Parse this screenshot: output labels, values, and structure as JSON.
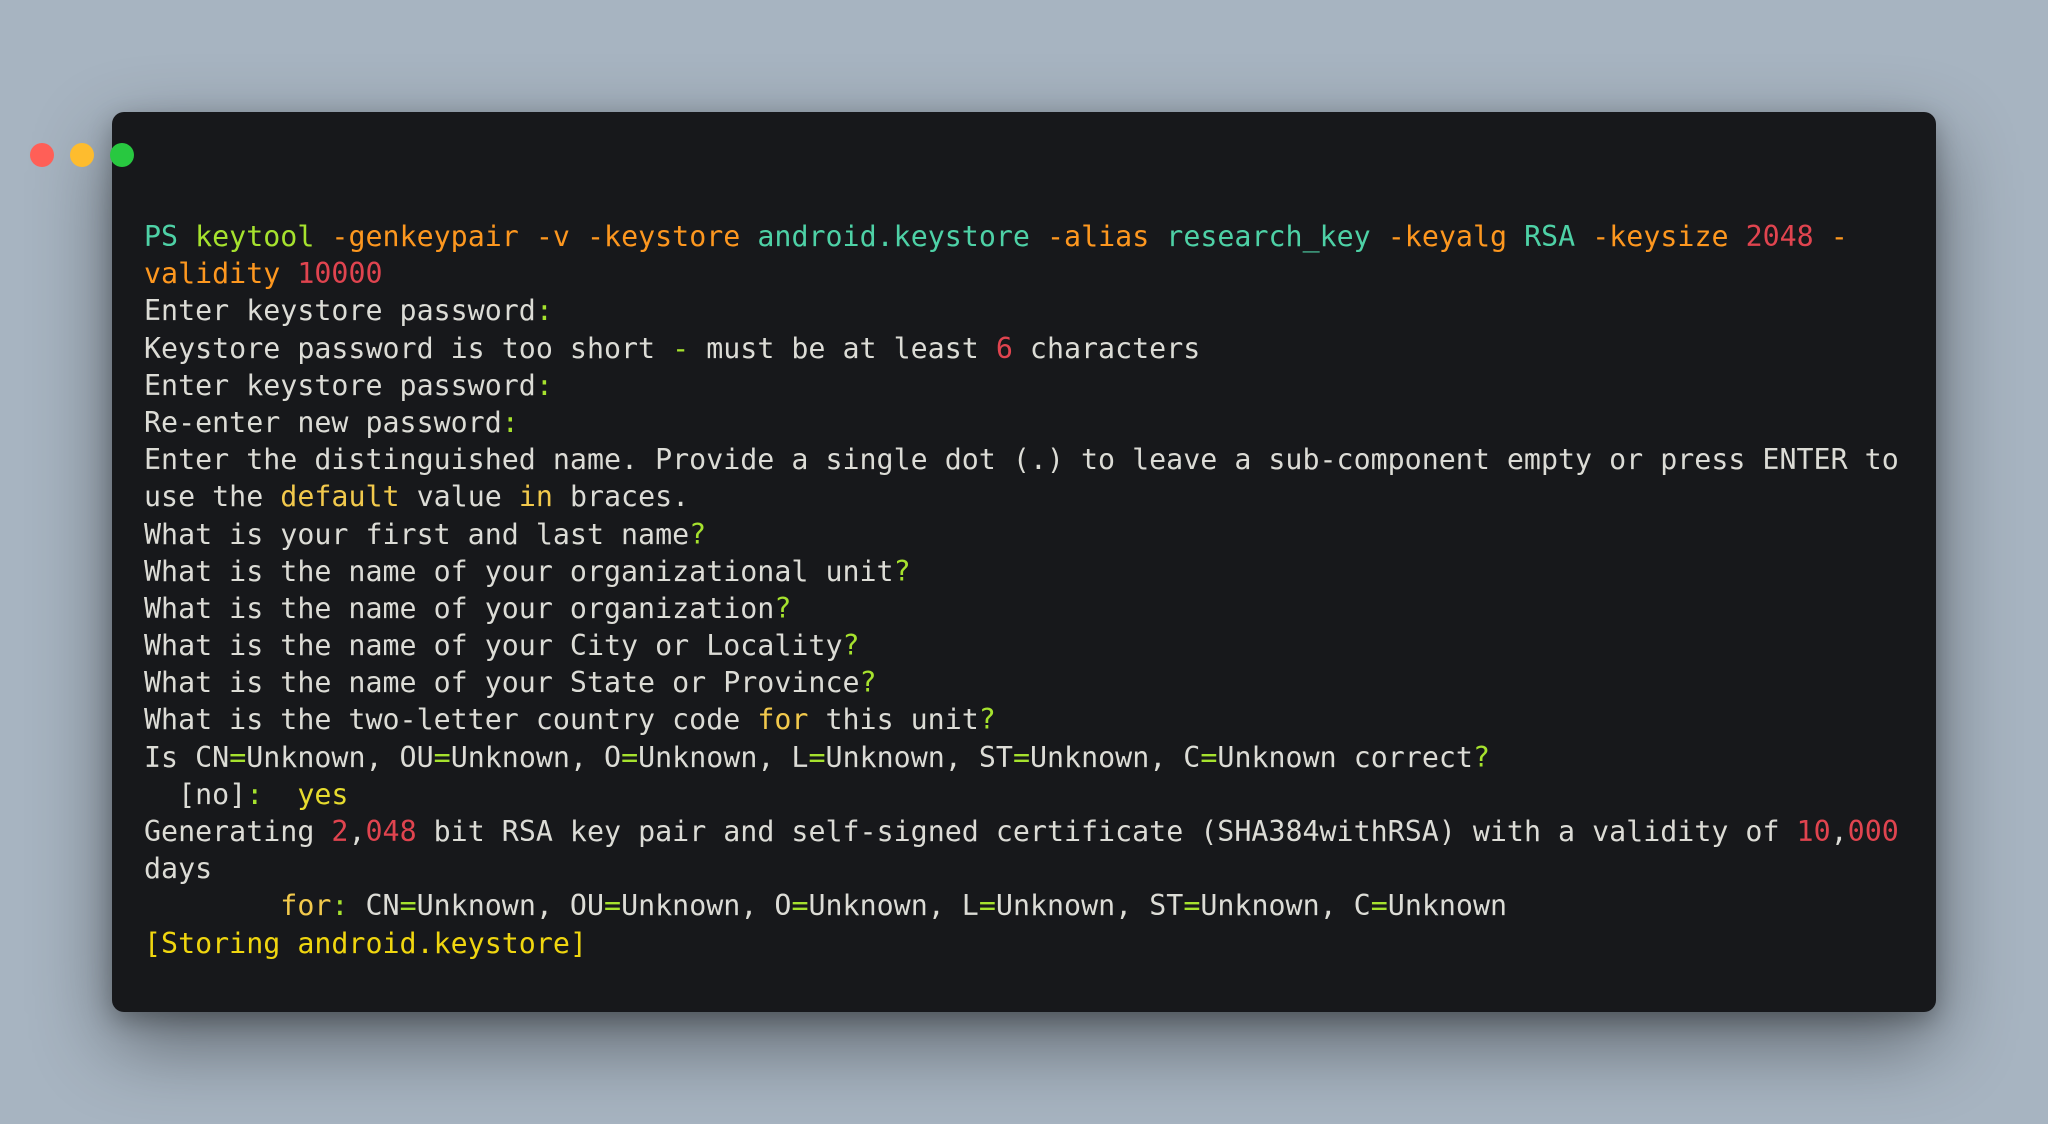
{
  "window": {
    "traffic_lights": [
      "close",
      "minimize",
      "maximize"
    ],
    "colors": {
      "background": "#17181b",
      "desktop": "#a7b4c1",
      "close": "#ff5f57",
      "minimize": "#febc2e",
      "maximize": "#28c840"
    }
  },
  "lines": [
    [
      {
        "t": "PS ",
        "c": "prompt"
      },
      {
        "t": "keytool",
        "c": "cmd"
      },
      {
        "t": " ",
        "c": ""
      },
      {
        "t": "-genkeypair",
        "c": "flag"
      },
      {
        "t": " ",
        "c": ""
      },
      {
        "t": "-v",
        "c": "flag"
      },
      {
        "t": " ",
        "c": ""
      },
      {
        "t": "-keystore",
        "c": "flag"
      },
      {
        "t": " ",
        "c": ""
      },
      {
        "t": "android.keystore",
        "c": "arg"
      },
      {
        "t": " ",
        "c": ""
      },
      {
        "t": "-alias",
        "c": "flag"
      },
      {
        "t": " ",
        "c": ""
      },
      {
        "t": "research_key",
        "c": "arg"
      },
      {
        "t": " ",
        "c": ""
      },
      {
        "t": "-keyalg",
        "c": "flag"
      },
      {
        "t": " ",
        "c": ""
      },
      {
        "t": "RSA",
        "c": "arg"
      },
      {
        "t": " ",
        "c": ""
      },
      {
        "t": "-keysize",
        "c": "flag"
      },
      {
        "t": " ",
        "c": ""
      },
      {
        "t": "2048",
        "c": "num"
      },
      {
        "t": " ",
        "c": ""
      },
      {
        "t": "-",
        "c": "flag"
      }
    ],
    [
      {
        "t": "validity",
        "c": "flag"
      },
      {
        "t": " ",
        "c": ""
      },
      {
        "t": "10000",
        "c": "num"
      }
    ],
    [
      {
        "t": "Enter keystore password",
        "c": ""
      },
      {
        "t": ":",
        "c": "punct"
      }
    ],
    [
      {
        "t": "Keystore password is too short ",
        "c": ""
      },
      {
        "t": "-",
        "c": "punct"
      },
      {
        "t": " must be at least ",
        "c": ""
      },
      {
        "t": "6",
        "c": "num"
      },
      {
        "t": " characters",
        "c": ""
      }
    ],
    [
      {
        "t": "Enter keystore password",
        "c": ""
      },
      {
        "t": ":",
        "c": "punct"
      }
    ],
    [
      {
        "t": "Re-enter new password",
        "c": ""
      },
      {
        "t": ":",
        "c": "punct"
      }
    ],
    [
      {
        "t": "Enter the distinguished name. Provide a single dot (.) to leave a sub-component empty or press ENTER to",
        "c": ""
      }
    ],
    [
      {
        "t": "use the ",
        "c": ""
      },
      {
        "t": "default",
        "c": "kw"
      },
      {
        "t": " value ",
        "c": ""
      },
      {
        "t": "in",
        "c": "kw"
      },
      {
        "t": " braces.",
        "c": ""
      }
    ],
    [
      {
        "t": "What is your first and last name",
        "c": ""
      },
      {
        "t": "?",
        "c": "punct"
      }
    ],
    [
      {
        "t": "What is the name of your organizational unit",
        "c": ""
      },
      {
        "t": "?",
        "c": "punct"
      }
    ],
    [
      {
        "t": "What is the name of your organization",
        "c": ""
      },
      {
        "t": "?",
        "c": "punct"
      }
    ],
    [
      {
        "t": "What is the name of your City or Locality",
        "c": ""
      },
      {
        "t": "?",
        "c": "punct"
      }
    ],
    [
      {
        "t": "What is the name of your State or Province",
        "c": ""
      },
      {
        "t": "?",
        "c": "punct"
      }
    ],
    [
      {
        "t": "What is the two-letter country code ",
        "c": ""
      },
      {
        "t": "for",
        "c": "kw"
      },
      {
        "t": " this unit",
        "c": ""
      },
      {
        "t": "?",
        "c": "punct"
      }
    ],
    [
      {
        "t": "Is CN",
        "c": ""
      },
      {
        "t": "=",
        "c": "punct"
      },
      {
        "t": "Unknown, OU",
        "c": ""
      },
      {
        "t": "=",
        "c": "punct"
      },
      {
        "t": "Unknown, O",
        "c": ""
      },
      {
        "t": "=",
        "c": "punct"
      },
      {
        "t": "Unknown, L",
        "c": ""
      },
      {
        "t": "=",
        "c": "punct"
      },
      {
        "t": "Unknown, ST",
        "c": ""
      },
      {
        "t": "=",
        "c": "punct"
      },
      {
        "t": "Unknown, C",
        "c": ""
      },
      {
        "t": "=",
        "c": "punct"
      },
      {
        "t": "Unknown correct",
        "c": ""
      },
      {
        "t": "?",
        "c": "punct"
      }
    ],
    [
      {
        "t": "  [no]",
        "c": ""
      },
      {
        "t": ":",
        "c": "punct"
      },
      {
        "t": "  ",
        "c": ""
      },
      {
        "t": "yes",
        "c": "yes"
      }
    ],
    [
      {
        "t": "Generating ",
        "c": ""
      },
      {
        "t": "2",
        "c": "num"
      },
      {
        "t": ",",
        "c": ""
      },
      {
        "t": "048",
        "c": "num"
      },
      {
        "t": " bit RSA key pair and self-signed certificate (SHA384withRSA) with a validity of ",
        "c": ""
      },
      {
        "t": "10",
        "c": "num"
      },
      {
        "t": ",",
        "c": ""
      },
      {
        "t": "000",
        "c": "num"
      }
    ],
    [
      {
        "t": "days",
        "c": ""
      }
    ],
    [
      {
        "t": "        ",
        "c": ""
      },
      {
        "t": "for",
        "c": "kw"
      },
      {
        "t": ":",
        "c": "punct"
      },
      {
        "t": " CN",
        "c": ""
      },
      {
        "t": "=",
        "c": "punct"
      },
      {
        "t": "Unknown, OU",
        "c": ""
      },
      {
        "t": "=",
        "c": "punct"
      },
      {
        "t": "Unknown, O",
        "c": ""
      },
      {
        "t": "=",
        "c": "punct"
      },
      {
        "t": "Unknown, L",
        "c": ""
      },
      {
        "t": "=",
        "c": "punct"
      },
      {
        "t": "Unknown, ST",
        "c": ""
      },
      {
        "t": "=",
        "c": "punct"
      },
      {
        "t": "Unknown, C",
        "c": ""
      },
      {
        "t": "=",
        "c": "punct"
      },
      {
        "t": "Unknown",
        "c": ""
      }
    ],
    [
      {
        "t": "[Storing android.keystore]",
        "c": "store"
      }
    ]
  ]
}
